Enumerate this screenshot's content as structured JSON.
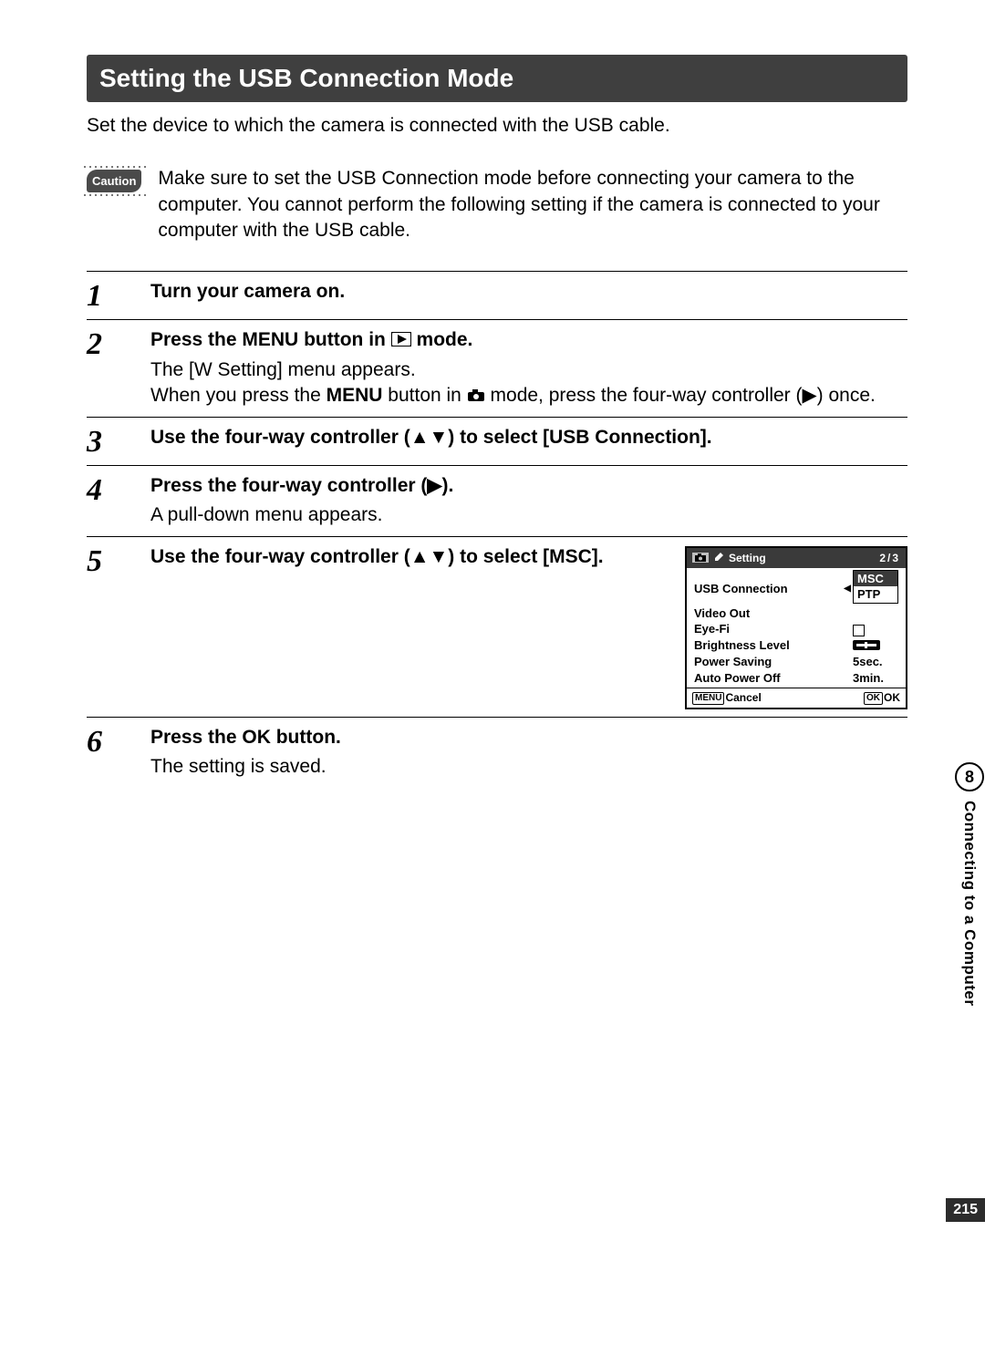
{
  "title": "Setting the USB Connection Mode",
  "intro": "Set the device to which the camera is connected with the USB cable.",
  "caution": {
    "label": "Caution",
    "text": "Make sure to set the USB Connection mode before connecting your camera to the computer. You cannot perform the following setting if the camera is connected to your computer with the USB cable."
  },
  "steps": {
    "s1": {
      "num": "1",
      "head": "Turn your camera on."
    },
    "s2": {
      "num": "2",
      "head_pre": "Press the ",
      "head_menu": "MENU",
      "head_post": " button in ",
      "head_end": " mode.",
      "desc1": "The [W Setting] menu appears.",
      "desc2a": "When you press the ",
      "desc2b": " button in ",
      "desc2c": " mode, press the four-way controller (",
      "desc2d": ") once."
    },
    "s3": {
      "num": "3",
      "head": "Use the four-way controller (▲▼) to select [USB Connection]."
    },
    "s4": {
      "num": "4",
      "head": "Press the four-way controller (▶).",
      "desc": "A pull-down menu appears."
    },
    "s5": {
      "num": "5",
      "head": "Use the four-way controller (▲▼) to select [MSC]."
    },
    "s6": {
      "num": "6",
      "head_pre": "Press the ",
      "head_ok": "OK",
      "head_post": " button.",
      "desc": "The setting is saved."
    }
  },
  "lcd": {
    "title": "Setting",
    "page": "2/3",
    "rows": {
      "usb": {
        "lbl": "USB Connection",
        "val": "MSC",
        "opt2": "PTP"
      },
      "vid": {
        "lbl": "Video Out",
        "val": ""
      },
      "eye": {
        "lbl": "Eye-Fi",
        "val": ""
      },
      "bri": {
        "lbl": "Brightness Level",
        "val": ""
      },
      "pwr": {
        "lbl": "Power Saving",
        "val": "5sec."
      },
      "apo": {
        "lbl": "Auto Power Off",
        "val": "3min."
      }
    },
    "foot": {
      "menu": "MENU",
      "cancel": "Cancel",
      "okbox": "OK",
      "ok": "OK"
    }
  },
  "side": {
    "num": "8",
    "text": "Connecting to a Computer"
  },
  "pagenum": "215"
}
